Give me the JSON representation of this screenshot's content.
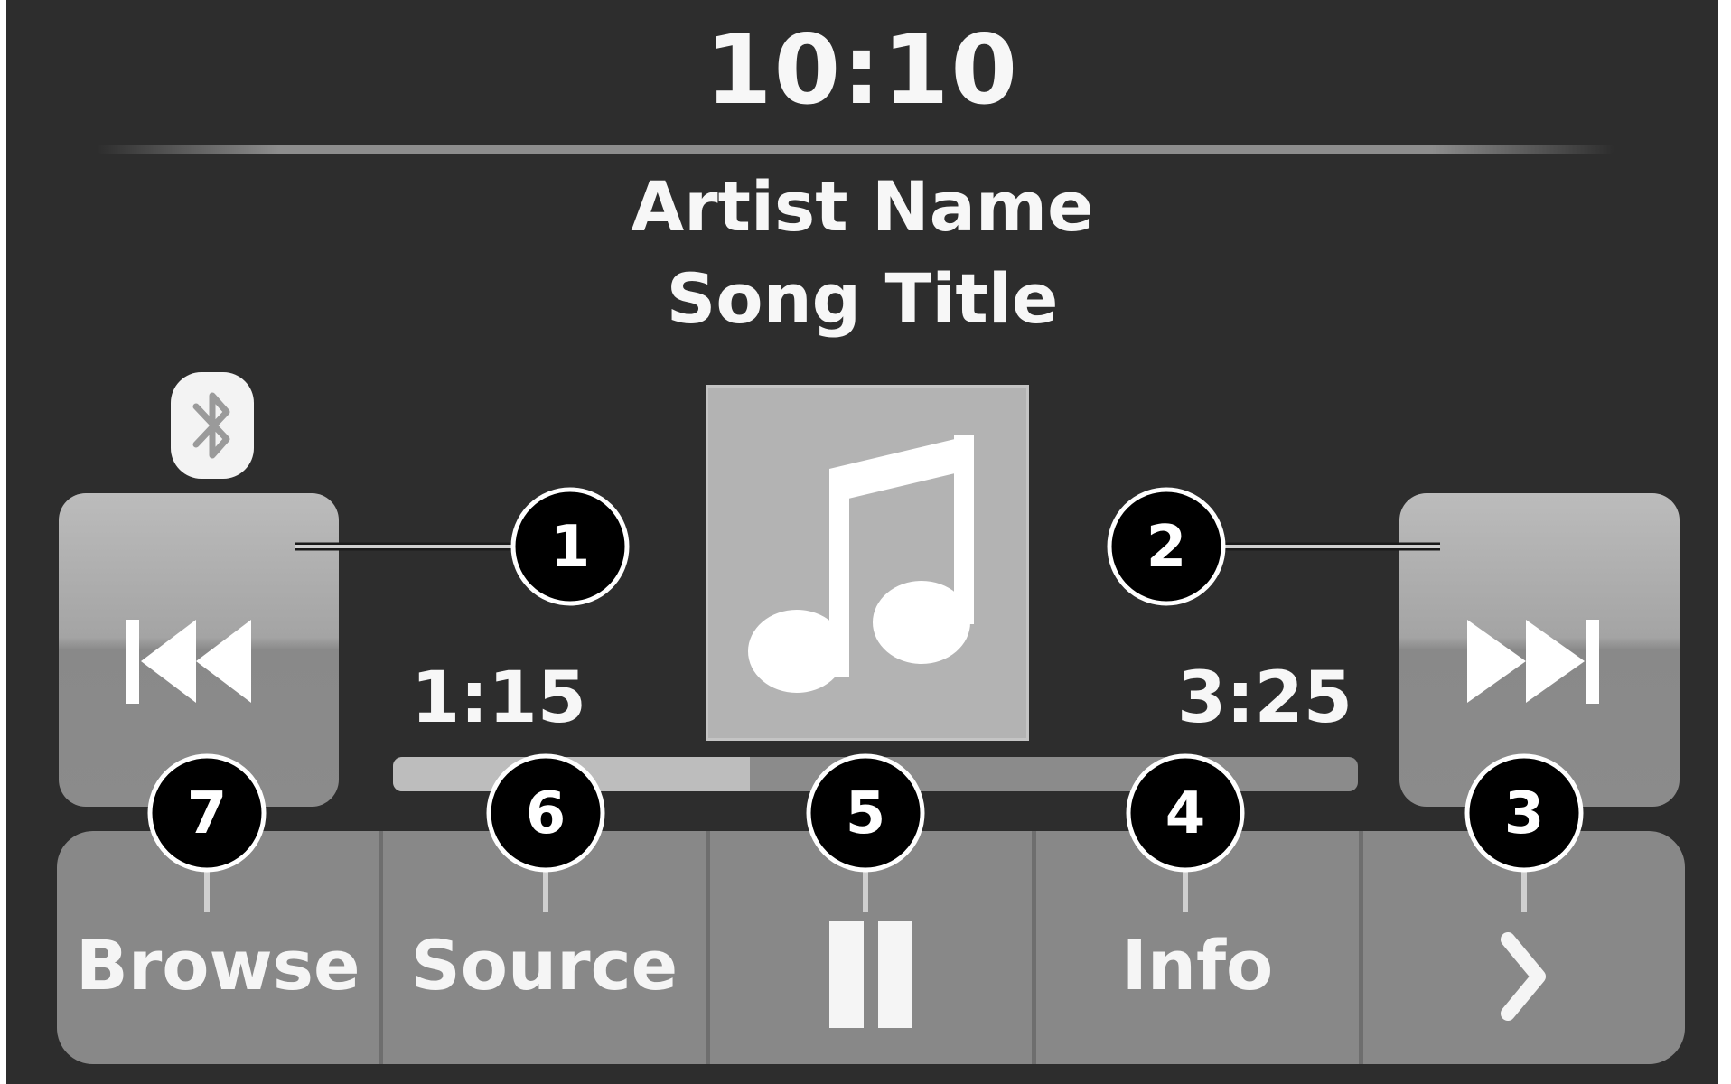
{
  "status": {
    "clock": "10:10",
    "bluetooth_icon": "bluetooth-icon"
  },
  "now_playing": {
    "artist": "Artist Name",
    "song": "Song Title",
    "album_art_icon": "music-note-icon",
    "elapsed": "1:15",
    "total": "3:25",
    "progress_fraction": 0.37
  },
  "controls": {
    "previous_icon": "skip-previous-icon",
    "next_icon": "skip-next-icon"
  },
  "bottom_bar": {
    "browse_label": "Browse",
    "source_label": "Source",
    "pause_icon": "pause-icon",
    "info_label": "Info",
    "more_icon": "chevron-right-icon"
  },
  "callouts": [
    "1",
    "2",
    "3",
    "4",
    "5",
    "6",
    "7"
  ],
  "colors": {
    "background": "#2d2d2d",
    "button_grey": "#888888",
    "text": "#f7f7f7",
    "callout_fill": "#000000",
    "callout_stroke": "#ffffff"
  }
}
